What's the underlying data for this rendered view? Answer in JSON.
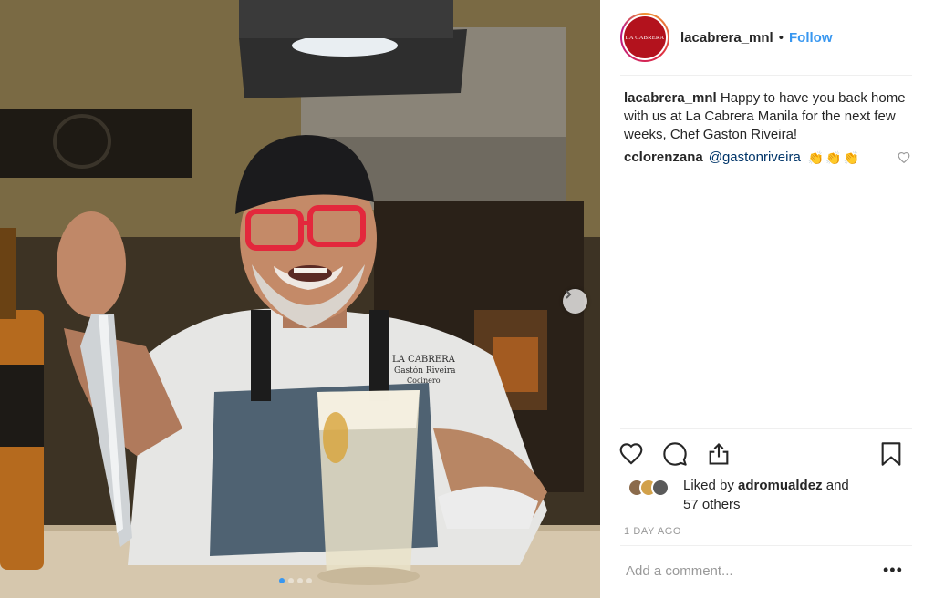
{
  "post": {
    "username": "lacabrera_mnl",
    "separator": "•",
    "follow_label": "Follow",
    "avatar_text": "LA CABRERA",
    "caption_username": "lacabrera_mnl",
    "caption_text": "Happy to have you back home with us at La Cabrera Manila for the next few weeks, Chef Gaston Riveira!"
  },
  "comments": [
    {
      "username": "cclorenzana",
      "mention": "@gastonriveira",
      "emoji": "👏👏👏"
    }
  ],
  "likes": {
    "prefix": "Liked by",
    "user": "adromualdez",
    "and": "and",
    "others": "57 others"
  },
  "timestamp": "1 DAY AGO",
  "add_comment": {
    "placeholder": "Add a comment..."
  },
  "more_label": "•••",
  "photo": {
    "apron_text": "LA CABRERA",
    "chef_name": "Gastón Riveira",
    "chef_title": "Cocinero",
    "slide_count": 4,
    "active_slide": 1
  },
  "icons": {
    "like": "heart-icon",
    "comment": "comment-icon",
    "share": "share-icon",
    "save": "bookmark-icon",
    "next": "chevron-right-icon"
  },
  "colors": {
    "accent": "#3897f0",
    "brand": "#b3121d"
  }
}
